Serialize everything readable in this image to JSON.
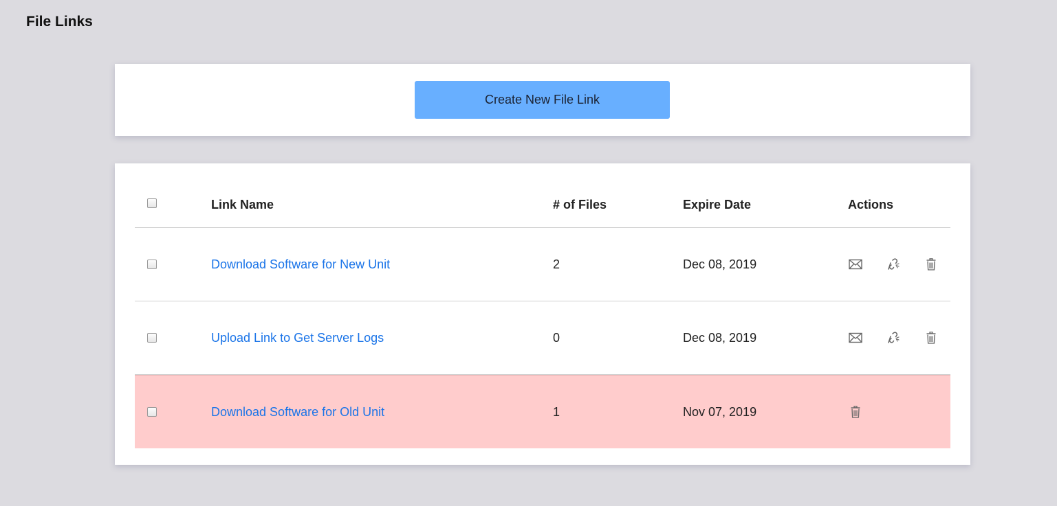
{
  "page": {
    "title": "File Links"
  },
  "create": {
    "label": "Create New File Link"
  },
  "table": {
    "headers": {
      "name": "Link Name",
      "files": "# of Files",
      "expire": "Expire Date",
      "actions": "Actions"
    },
    "rows": [
      {
        "name": "Download Software for New Unit",
        "files": "2",
        "expire": "Dec 08, 2019",
        "actions": [
          "mail-icon",
          "unlink-icon",
          "trash-icon"
        ]
      },
      {
        "name": "Upload Link to Get Server Logs",
        "files": "0",
        "expire": "Dec 08, 2019",
        "actions": [
          "mail-icon",
          "unlink-icon",
          "trash-icon"
        ]
      },
      {
        "name": "Download Software for Old Unit",
        "files": "1",
        "expire": "Nov 07, 2019",
        "actions": [
          "trash-icon"
        ],
        "expired": true
      }
    ]
  },
  "colors": {
    "background": "#dcdbe0",
    "button": "#68afff",
    "link": "#1a74e8",
    "expired_row": "#ffcccc",
    "icon": "#666666"
  }
}
